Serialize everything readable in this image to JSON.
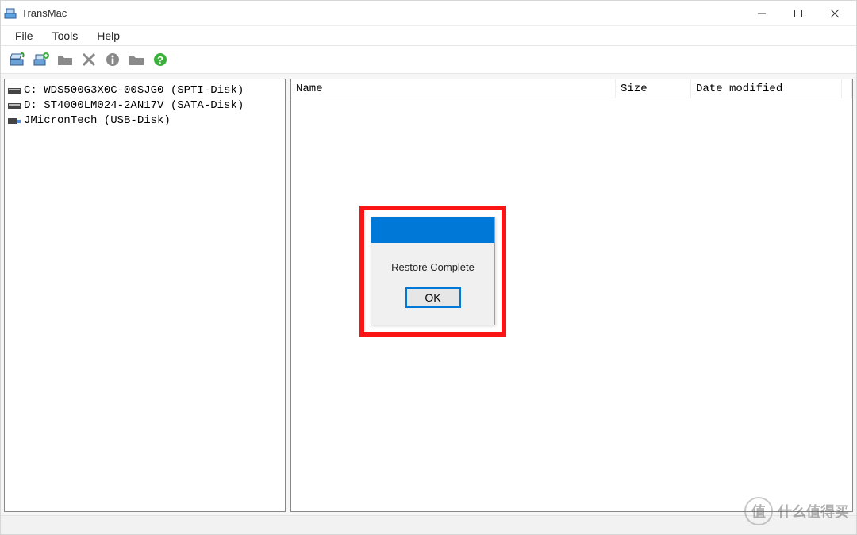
{
  "app": {
    "title": "TransMac"
  },
  "menu": {
    "file": "File",
    "tools": "Tools",
    "help": "Help"
  },
  "tree": {
    "items": [
      {
        "label": "C: WDS500G3X0C-00SJG0 (SPTI-Disk)"
      },
      {
        "label": "D: ST4000LM024-2AN17V (SATA-Disk)"
      },
      {
        "label": "JMicronTech (USB-Disk)"
      }
    ]
  },
  "columns": {
    "name": "Name",
    "size": "Size",
    "date": "Date modified"
  },
  "dialog": {
    "message": "Restore Complete",
    "ok": "OK"
  },
  "watermark": {
    "badge": "值",
    "text": "什么值得买"
  }
}
